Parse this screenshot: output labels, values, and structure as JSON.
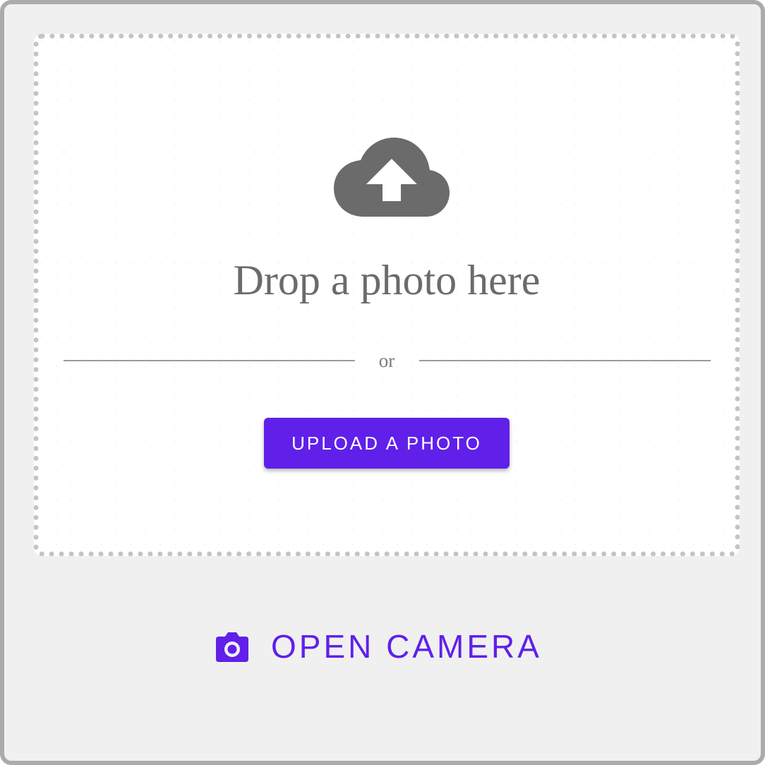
{
  "dropzone": {
    "title": "Drop a photo here",
    "divider_text": "or",
    "upload_label": "UPLOAD A PHOTO",
    "icon": "cloud-upload-icon"
  },
  "camera": {
    "label": "OPEN CAMERA",
    "icon": "camera-icon"
  },
  "colors": {
    "accent": "#6020ea",
    "icon_gray": "#6b6b6b",
    "frame_border": "#ababab",
    "background": "#f0f0f0"
  }
}
